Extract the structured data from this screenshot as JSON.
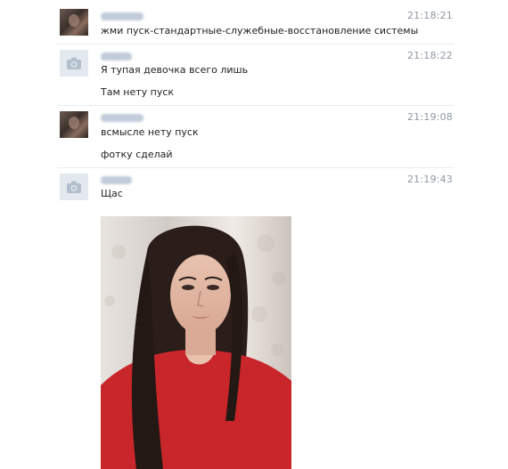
{
  "messages": [
    {
      "avatar": "photo-avatar",
      "text": "жми пуск-стандартные-служебные-восстановление системы",
      "time": "21:18:21"
    },
    {
      "avatar": "camera-avatar",
      "text": "Я тупая девочка всего лишь",
      "text2": "Там нету пуск",
      "time": "21:18:22"
    },
    {
      "avatar": "photo-avatar",
      "text": "всмысле нету пуск",
      "text2": "фотку сделай",
      "time": "21:19:08"
    },
    {
      "avatar": "camera-avatar",
      "text": "Щас",
      "time": "21:19:43"
    }
  ],
  "attachment": {
    "type": "photo",
    "icon": "selfie-photo"
  },
  "colors": {
    "time": "#8d97a3",
    "text": "#1f1f1f",
    "blurred_name": "#b7c3d3",
    "default_avatar_bg": "#e4e9ef",
    "shirt": "#c8262a"
  }
}
